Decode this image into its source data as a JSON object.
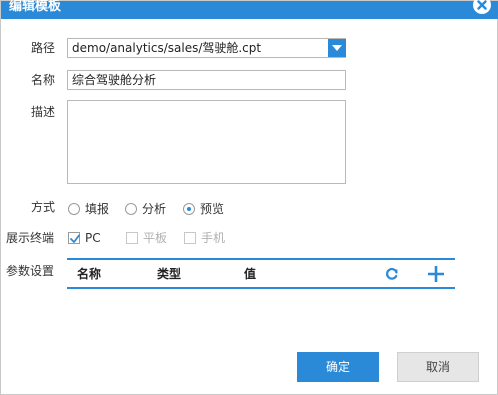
{
  "dialog": {
    "title": "编辑模板"
  },
  "form": {
    "path_label": "路径",
    "path_value": "demo/analytics/sales/驾驶舱.cpt",
    "name_label": "名称",
    "name_value": "综合驾驶舱分析",
    "desc_label": "描述",
    "desc_value": "",
    "mode_label": "方式",
    "mode_options": [
      {
        "label": "填报",
        "checked": false
      },
      {
        "label": "分析",
        "checked": false
      },
      {
        "label": "预览",
        "checked": true
      }
    ],
    "terminal_label": "展示终端",
    "terminal_options": [
      {
        "label": "PC",
        "checked": true,
        "disabled": false
      },
      {
        "label": "平板",
        "checked": false,
        "disabled": true
      },
      {
        "label": "手机",
        "checked": false,
        "disabled": true
      }
    ],
    "params_label": "参数设置",
    "params_columns": [
      "名称",
      "类型",
      "值"
    ]
  },
  "footer": {
    "ok_label": "确定",
    "cancel_label": "取消"
  },
  "colors": {
    "accent": "#2a8ad8",
    "disabled_text": "#b0b0b0"
  },
  "icons": {
    "close": "close-icon",
    "dropdown": "chevron-down-icon",
    "refresh": "refresh-icon",
    "add": "plus-icon",
    "check": "check-icon"
  }
}
